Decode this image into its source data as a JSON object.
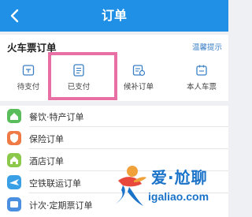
{
  "header": {
    "title": "订单",
    "back_icon": "chevron-left-icon"
  },
  "train_card": {
    "title": "火车票订单",
    "tip": "温馨提示",
    "entries": [
      {
        "label": "待支付",
        "icon": "pending-payment-icon"
      },
      {
        "label": "已支付",
        "icon": "paid-document-icon"
      },
      {
        "label": "候补订单",
        "icon": "waitlist-icon"
      },
      {
        "label": "本人车票",
        "icon": "my-ticket-icon"
      }
    ]
  },
  "order_list": [
    {
      "label": "餐饮·特产订单",
      "icon": "food-icon",
      "color": "#58bd5a"
    },
    {
      "label": "保险订单",
      "icon": "insurance-icon",
      "color": "#f07a45"
    },
    {
      "label": "酒店订单",
      "icon": "hotel-icon",
      "color": "#8cc84b"
    },
    {
      "label": "空铁联运订单",
      "icon": "air-rail-icon",
      "color": "#3aa0e6"
    },
    {
      "label": "计次·定期票订单",
      "icon": "pass-ticket-icon",
      "color": "#4a8fe0"
    }
  ],
  "colors": {
    "header": "#1f90e6",
    "highlight": "#e76fa3",
    "link": "#3a7fc6"
  },
  "watermark": {
    "line1": "爱·尬聊",
    "line2": "igaliao.com"
  }
}
